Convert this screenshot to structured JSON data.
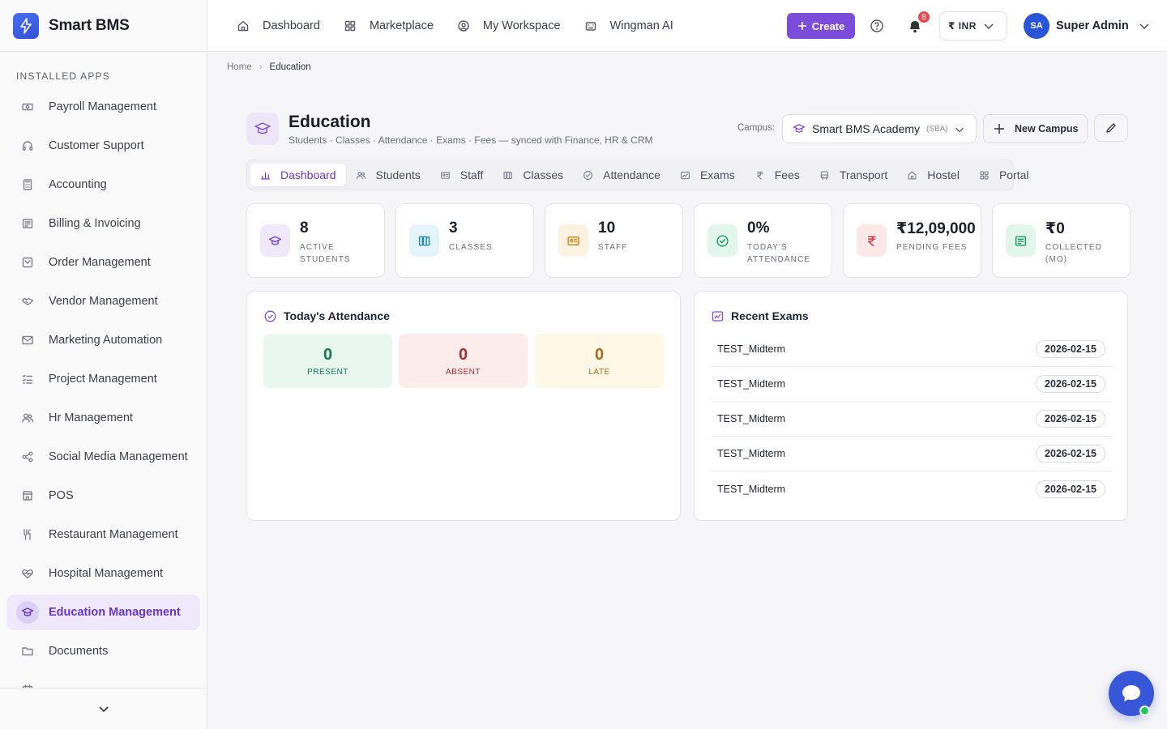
{
  "brand": {
    "name": "Smart BMS"
  },
  "sidebar": {
    "section_title": "INSTALLED APPS",
    "items": [
      {
        "label": "Payroll Management",
        "icon": "money-icon"
      },
      {
        "label": "Customer Support",
        "icon": "headset-icon"
      },
      {
        "label": "Accounting",
        "icon": "calculator-icon"
      },
      {
        "label": "Billing & Invoicing",
        "icon": "receipt-icon"
      },
      {
        "label": "Order Management",
        "icon": "order-icon"
      },
      {
        "label": "Vendor Management",
        "icon": "handshake-icon"
      },
      {
        "label": "Marketing Automation",
        "icon": "mail-icon"
      },
      {
        "label": "Project Management",
        "icon": "checklist-icon"
      },
      {
        "label": "Hr Management",
        "icon": "users-icon"
      },
      {
        "label": "Social Media Management",
        "icon": "share-icon"
      },
      {
        "label": "POS",
        "icon": "store-icon"
      },
      {
        "label": "Restaurant Management",
        "icon": "utensils-icon"
      },
      {
        "label": "Hospital Management",
        "icon": "heartbeat-icon"
      },
      {
        "label": "Education Management",
        "icon": "graduation-cap-icon",
        "active": true
      },
      {
        "label": "Documents",
        "icon": "folder-icon"
      },
      {
        "label": "",
        "icon": "calendar-icon"
      }
    ]
  },
  "topbar": {
    "nav": [
      {
        "label": "Dashboard",
        "icon": "home-icon"
      },
      {
        "label": "Marketplace",
        "icon": "grid-icon"
      },
      {
        "label": "My Workspace",
        "icon": "user-circle-icon"
      },
      {
        "label": "Wingman AI",
        "icon": "bot-icon"
      }
    ],
    "create_label": "Create",
    "notifications_count": "8",
    "currency_symbol": "₹",
    "currency": "INR",
    "user_initials": "SA",
    "user_name": "Super Admin"
  },
  "breadcrumb": {
    "home": "Home",
    "current": "Education"
  },
  "page": {
    "title": "Education",
    "subtitle": "Students · Classes · Attendance · Exams · Fees — synced with Finance, HR & CRM",
    "campus_label": "Campus:",
    "campus_name": "Smart BMS Academy",
    "campus_code": "(SBA)",
    "new_campus_label": "New Campus"
  },
  "tabs": [
    {
      "label": "Dashboard",
      "icon": "bar-chart-icon",
      "active": true
    },
    {
      "label": "Students",
      "icon": "users-icon"
    },
    {
      "label": "Staff",
      "icon": "id-card-icon"
    },
    {
      "label": "Classes",
      "icon": "books-icon"
    },
    {
      "label": "Attendance",
      "icon": "check-circle-icon"
    },
    {
      "label": "Exams",
      "icon": "image-chart-icon"
    },
    {
      "label": "Fees",
      "icon": "rupee-icon"
    },
    {
      "label": "Transport",
      "icon": "bus-icon"
    },
    {
      "label": "Hostel",
      "icon": "home-icon"
    },
    {
      "label": "Portal",
      "icon": "grid-icon"
    }
  ],
  "stats": [
    {
      "value": "8",
      "label": "Active Students",
      "icon": "graduation-cap-icon",
      "color": "#7c4ddb",
      "bg": "#efe9fb"
    },
    {
      "value": "3",
      "label": "Classes",
      "icon": "books-icon",
      "color": "#1f8fb0",
      "bg": "#e4f4f8"
    },
    {
      "value": "10",
      "label": "Staff",
      "icon": "id-card-icon",
      "color": "#d08a1c",
      "bg": "#fcf2e1"
    },
    {
      "value": "0%",
      "label": "Today's Attendance",
      "icon": "check-circle-icon",
      "color": "#1e9e67",
      "bg": "#e3f6ee"
    },
    {
      "value": "₹12,09,000",
      "label": "Pending Fees",
      "icon": "rupee-icon",
      "color": "#d9363e",
      "bg": "#fde8e8"
    },
    {
      "value": "₹0",
      "label": "Collected (MO)",
      "icon": "receipt-icon",
      "color": "#1e9e67",
      "bg": "#e3f6ee"
    }
  ],
  "attendance": {
    "title": "Today's Attendance",
    "present": {
      "value": "0",
      "label": "PRESENT"
    },
    "absent": {
      "value": "0",
      "label": "ABSENT"
    },
    "late": {
      "value": "0",
      "label": "LATE"
    }
  },
  "exams": {
    "title": "Recent Exams",
    "rows": [
      {
        "name": "TEST_Midterm",
        "date": "2026-02-15"
      },
      {
        "name": "TEST_Midterm",
        "date": "2026-02-15"
      },
      {
        "name": "TEST_Midterm",
        "date": "2026-02-15"
      },
      {
        "name": "TEST_Midterm",
        "date": "2026-02-15"
      },
      {
        "name": "TEST_Midterm",
        "date": "2026-02-15"
      }
    ]
  }
}
